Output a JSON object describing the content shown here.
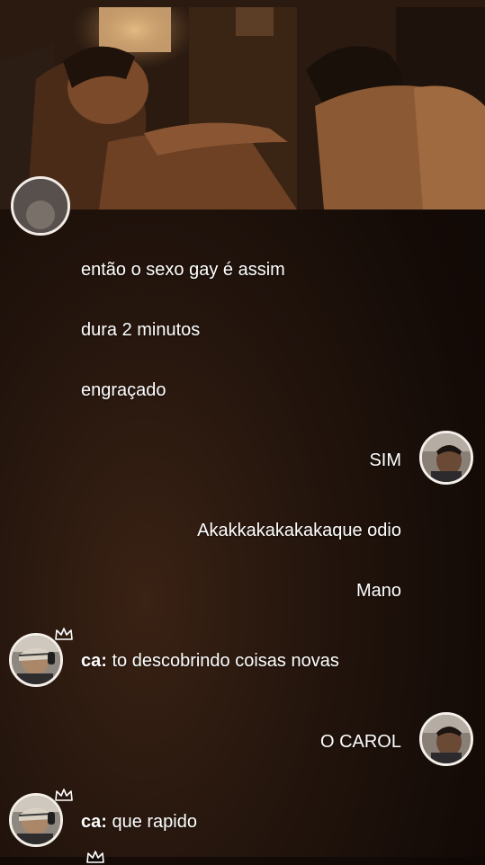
{
  "chat": {
    "messages": [
      {
        "side": "left",
        "text": "então o sexo gay é assim"
      },
      {
        "side": "left",
        "text": "dura 2 minutos"
      },
      {
        "side": "left",
        "text": "engraçado"
      },
      {
        "side": "right",
        "text": "SIM"
      },
      {
        "side": "right",
        "text": "Akakkakakakakaque odio"
      },
      {
        "side": "right",
        "text": "Mano"
      },
      {
        "side": "left",
        "sender": "ca:",
        "text": "to descobrindo coisas novas"
      },
      {
        "side": "right",
        "text": "O CAROL"
      },
      {
        "side": "left",
        "sender": "ca:",
        "text": "que rapido"
      }
    ]
  },
  "colors": {
    "background": "#1a0f09",
    "text": "#ffffff",
    "avatar_border": "#f4efe9"
  },
  "icons": {
    "crown": "crown-icon"
  }
}
